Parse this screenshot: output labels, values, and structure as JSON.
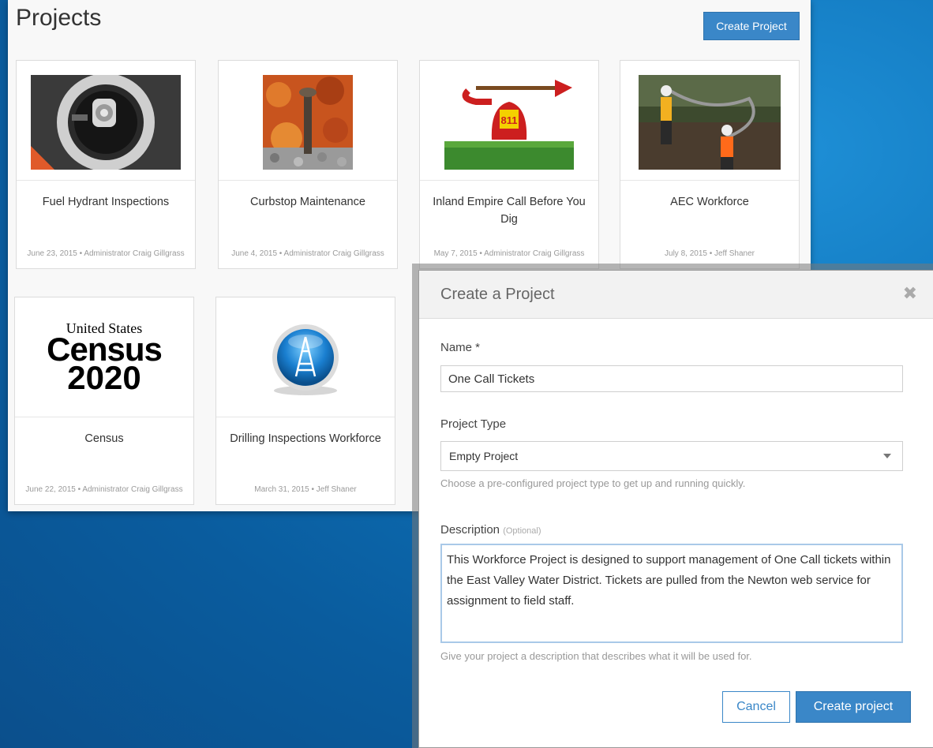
{
  "projects": {
    "title": "Projects",
    "create_label": "Create Project",
    "cards": [
      {
        "name": "Fuel Hydrant Inspections",
        "meta": "June 23, 2015 • Administrator Craig Gillgrass"
      },
      {
        "name": "Curbstop Maintenance",
        "meta": "June 4, 2015 • Administrator Craig Gillgrass"
      },
      {
        "name": "Inland Empire Call Before You Dig",
        "meta": "May 7, 2015 • Administrator Craig Gillgrass"
      },
      {
        "name": "AEC Workforce",
        "meta": "July 8, 2015 • Jeff Shaner"
      },
      {
        "name": "Census",
        "meta": "June 22, 2015 • Administrator Craig Gillgrass"
      },
      {
        "name": "Drilling Inspections Workforce",
        "meta": "March 31, 2015 • Jeff Shaner"
      }
    ],
    "census_logo": {
      "line1": "United States",
      "line2": "Census",
      "line3": "2020"
    },
    "phone_label": "811"
  },
  "modal": {
    "title": "Create a Project",
    "name_label": "Name *",
    "name_value": "One Call Tickets",
    "type_label": "Project Type",
    "type_value": "Empty Project",
    "type_hint": "Choose a pre-configured project type to get up and running quickly.",
    "desc_label": "Description",
    "desc_optional": "(Optional)",
    "desc_value": "This Workforce Project is designed to support management of One Call tickets within the East Valley Water District. Tickets are pulled from the Newton web service for assignment to field staff.",
    "desc_hint": "Give your project a description that describes what it will be used for.",
    "cancel_label": "Cancel",
    "create_label": "Create project"
  }
}
